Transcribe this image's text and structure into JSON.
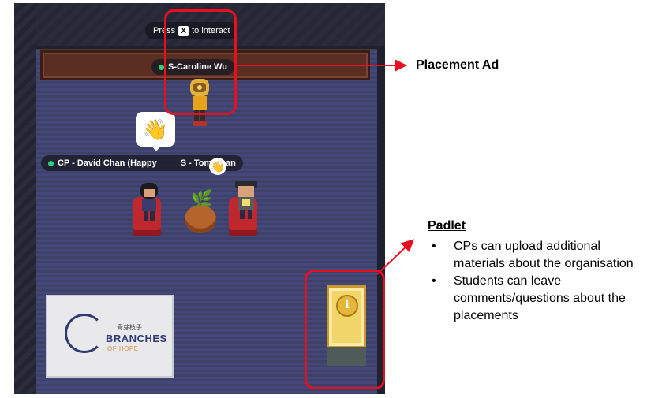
{
  "game": {
    "prompt_before": "Press",
    "prompt_key": "X",
    "prompt_after": "to interact",
    "booth_name": "S-Caroline Wu",
    "group_name": "CP - David Chan (Happy",
    "group_name_2": "S - Tom Chan",
    "reaction_emoji": "👋",
    "logo": {
      "cn_text": "青芽枝子",
      "title": "BRANCHES",
      "subtitle": "OF HOPE"
    },
    "padlet_icon": "i"
  },
  "annotations": {
    "placement_ad": "Placement Ad",
    "padlet_title": "Padlet",
    "padlet_points": [
      "CPs can upload additional materials about the organisation",
      "Students can leave comments/questions about the placements"
    ]
  },
  "colors": {
    "highlight": "#e8101e",
    "online_dot": "#2bd47a",
    "floor": "#3e4168",
    "booth": "#5a2e22"
  }
}
